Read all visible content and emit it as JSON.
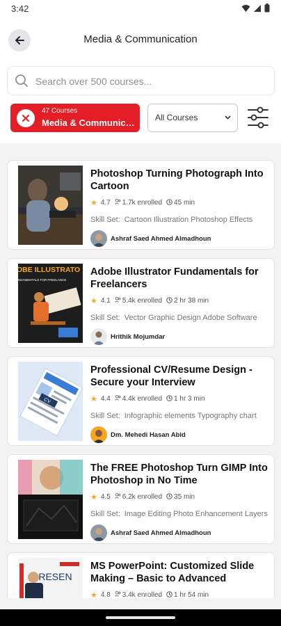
{
  "status": {
    "time": "3:42"
  },
  "header": {
    "title": "Media & Communication",
    "search_placeholder": "Search over 500 courses..."
  },
  "filter": {
    "count_label": "47 Courses",
    "category_name": "Media & Communication",
    "dropdown_value": "All Courses"
  },
  "colors": {
    "accent": "#e31e26",
    "star": "#f5a623"
  },
  "courses": [
    {
      "title": "Photoshop Turning Photograph Into Cartoon",
      "rating": "4.7",
      "enrolled": "1.7k enrolled",
      "duration": "45 min",
      "skill_label": "Skill Set:",
      "skills": "Cartoon Illustration Photoshop Effects",
      "author": "Ashraf Saed Ahmed Almadhoun"
    },
    {
      "title": "Adobe Illustrator Fundamentals for Freelancers",
      "rating": "4.1",
      "enrolled": "5.4k enrolled",
      "duration": "2 hr 38 min",
      "skill_label": "Skill Set:",
      "skills": "Vector Graphic Design Adobe Software",
      "author": "Hrithik Mojumdar",
      "thumb_text1": "OBE ILLUSTRATO",
      "thumb_text2": "NDAMENTALS FOR FREELANCE"
    },
    {
      "title": "Professional CV/Resume Design - Secure your Interview",
      "rating": "4.4",
      "enrolled": "4.4k enrolled",
      "duration": "1 hr 3 min",
      "skill_label": "Skill Set:",
      "skills": "Infographic elements Typography chart",
      "author": "Dm. Mehedi Hasan Abid",
      "thumb_text": "CV"
    },
    {
      "title": "The FREE Photoshop Turn GIMP Into Photoshop in No Time",
      "rating": "4.5",
      "enrolled": "6.2k enrolled",
      "duration": "35 min",
      "skill_label": "Skill Set:",
      "skills": "Image Editing Photo Enhancement Layers",
      "author": "Ashraf Saed Ahmed Almadhoun"
    },
    {
      "title": "MS PowerPoint: Customized Slide Making – Basic to Advanced",
      "rating": "4.8",
      "enrolled": "3.4k enrolled",
      "duration": "1 hr 54 min",
      "thumb_text": "PRESEN"
    }
  ]
}
